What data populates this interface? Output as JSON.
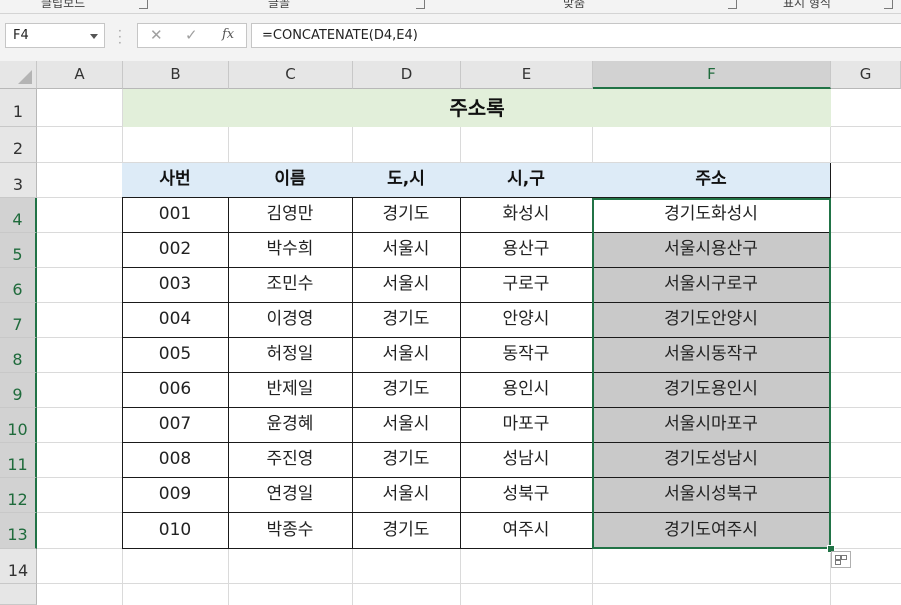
{
  "ribbon": {
    "groups": [
      "클립보드",
      "글꼴",
      "맞춤",
      "표시 형식"
    ]
  },
  "formula_bar": {
    "name_box": "F4",
    "fx_label": "fx",
    "formula": "=CONCATENATE(D4,E4)"
  },
  "columns": [
    "A",
    "B",
    "C",
    "D",
    "E",
    "F",
    "G"
  ],
  "rows": [
    "1",
    "2",
    "3",
    "4",
    "5",
    "6",
    "7",
    "8",
    "9",
    "10",
    "11",
    "12",
    "13",
    "14"
  ],
  "sheet": {
    "title": "주소록",
    "headers": [
      "사번",
      "이름",
      "도,시",
      "시,구",
      "주소"
    ],
    "records": [
      [
        "001",
        "김영만",
        "경기도",
        "화성시",
        "경기도화성시"
      ],
      [
        "002",
        "박수희",
        "서울시",
        "용산구",
        "서울시용산구"
      ],
      [
        "003",
        "조민수",
        "서울시",
        "구로구",
        "서울시구로구"
      ],
      [
        "004",
        "이경영",
        "경기도",
        "안양시",
        "경기도안양시"
      ],
      [
        "005",
        "허정일",
        "서울시",
        "동작구",
        "서울시동작구"
      ],
      [
        "006",
        "반제일",
        "경기도",
        "용인시",
        "경기도용인시"
      ],
      [
        "007",
        "윤경혜",
        "서울시",
        "마포구",
        "서울시마포구"
      ],
      [
        "008",
        "주진영",
        "경기도",
        "성남시",
        "경기도성남시"
      ],
      [
        "009",
        "연경일",
        "서울시",
        "성북구",
        "서울시성북구"
      ],
      [
        "010",
        "박종수",
        "경기도",
        "여주시",
        "경기도여주시"
      ]
    ]
  },
  "colors": {
    "title_fill": "#e2efda",
    "header_fill": "#ddebf7",
    "shaded_fill": "#c9c9c9",
    "selection": "#217346"
  }
}
